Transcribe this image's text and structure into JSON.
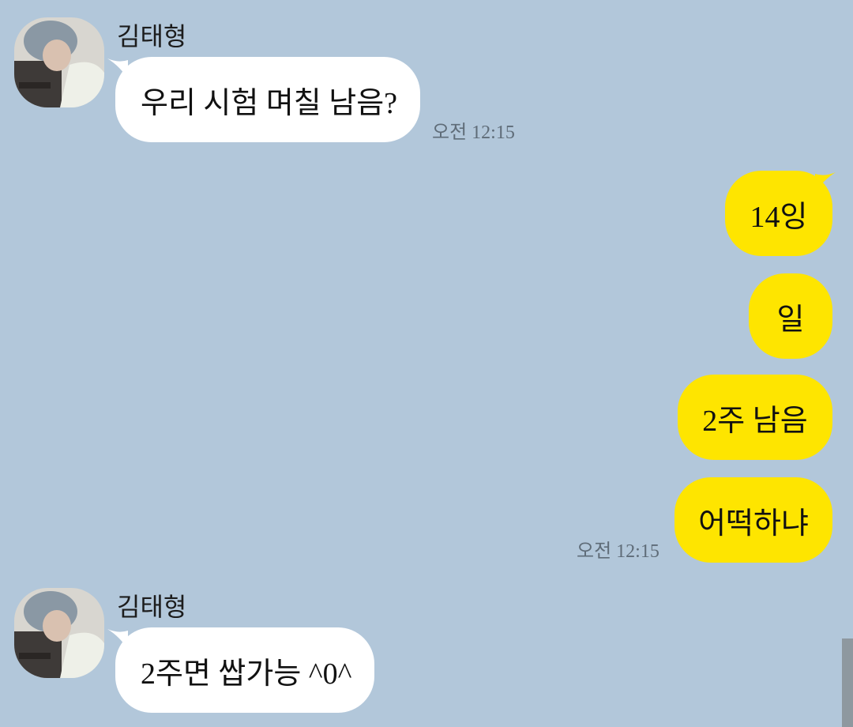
{
  "messages": [
    {
      "sender": "김태형",
      "text": "우리 시험 며칠 남음?",
      "time": "오전 12:15"
    },
    {
      "outgoing": [
        "14잉",
        "일",
        "2주 남음",
        "어떡하냐"
      ],
      "time": "오전 12:15"
    },
    {
      "sender": "김태형",
      "text": "2주면 쌉가능 ^0^"
    }
  ],
  "colors": {
    "background": "#b2c7da",
    "incoming_bubble": "#ffffff",
    "outgoing_bubble": "#fee500",
    "timestamp": "#5f6c78"
  },
  "icons": {
    "avatar": "profile-photo-avatar"
  }
}
